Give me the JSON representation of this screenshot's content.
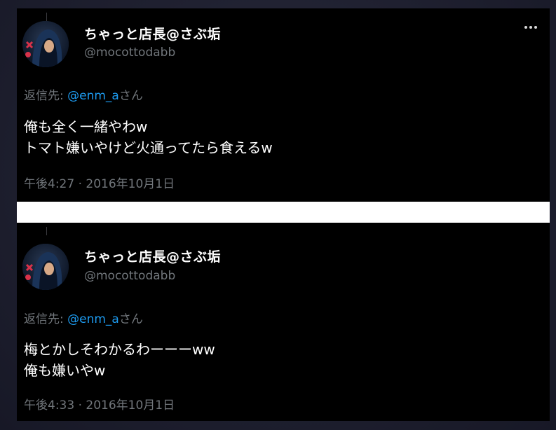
{
  "tweets": [
    {
      "display_name": "ちゃっと店長@さぶ垢",
      "handle": "@mocottodabb",
      "reply_prefix": "返信先: ",
      "reply_mention": "@enm_a",
      "reply_suffix": "さん",
      "text_lines": [
        "俺も全く一緒やわw",
        "トマト嫌いやけど火通ってたら食えるw"
      ],
      "timestamp": "午後4:27 · 2016年10月1日",
      "more_icon": "more-dots-icon"
    },
    {
      "display_name": "ちゃっと店長@さぶ垢",
      "handle": "@mocottodabb",
      "reply_prefix": "返信先: ",
      "reply_mention": "@enm_a",
      "reply_suffix": "さん",
      "text_lines": [
        "梅とかしそわかるわーーーww",
        "俺も嫌いやw"
      ],
      "timestamp": "午後4:33 · 2016年10月1日"
    }
  ],
  "colors": {
    "background": "#000000",
    "text": "#ffffff",
    "secondary": "#71767b",
    "link": "#1d9bf0"
  }
}
